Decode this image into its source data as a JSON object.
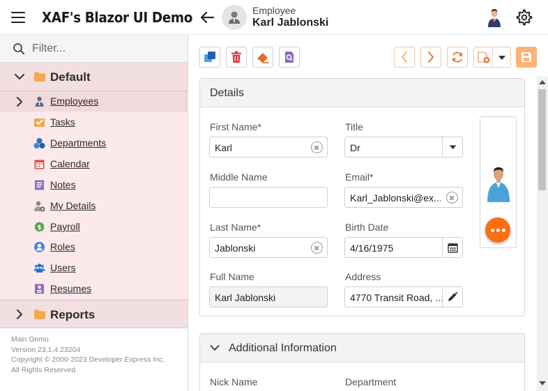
{
  "app": {
    "title": "XAF's Blazor UI Demo"
  },
  "header": {
    "object_type": "Employee",
    "object_name": "Karl Jablonski"
  },
  "sidebar": {
    "filter_placeholder": "Filter...",
    "groups": [
      {
        "label": "Default",
        "expanded": true
      },
      {
        "label": "Reports",
        "expanded": false
      }
    ],
    "items": [
      {
        "label": "Employees",
        "icon": "employee-icon"
      },
      {
        "label": "Tasks",
        "icon": "tasks-icon"
      },
      {
        "label": "Departments",
        "icon": "departments-icon"
      },
      {
        "label": "Calendar",
        "icon": "calendar-icon"
      },
      {
        "label": "Notes",
        "icon": "notes-icon"
      },
      {
        "label": "My Details",
        "icon": "my-details-icon"
      },
      {
        "label": "Payroll",
        "icon": "payroll-icon"
      },
      {
        "label": "Roles",
        "icon": "roles-icon"
      },
      {
        "label": "Users",
        "icon": "users-icon"
      },
      {
        "label": "Resumes",
        "icon": "resumes-icon"
      }
    ],
    "selected": "Employees",
    "footer": {
      "line1": "Main Demo",
      "line2": "Version 23.1.4.23204",
      "line3": "Copyright © 2000-2023 Developer Express Inc.",
      "line4": "All Rights Reserved"
    }
  },
  "toolbar": {
    "buttons": [
      "new-icon",
      "delete-icon",
      "reset-icon",
      "preview-icon",
      "previous-icon",
      "next-icon",
      "refresh-icon",
      "save-and-new-icon",
      "dropdown-icon",
      "save-icon"
    ],
    "accent_color": "#fb6f10"
  },
  "details": {
    "title": "Details",
    "first_name": {
      "label": "First Name*",
      "value": "Karl"
    },
    "middle_name": {
      "label": "Middle Name",
      "value": ""
    },
    "last_name": {
      "label": "Last Name*",
      "value": "Jablonski"
    },
    "full_name": {
      "label": "Full Name",
      "value": "Karl Jablonski"
    },
    "title_field": {
      "label": "Title",
      "value": "Dr"
    },
    "email": {
      "label": "Email*",
      "value": "Karl_Jablonski@ex..."
    },
    "birth_date": {
      "label": "Birth Date",
      "value": "4/16/1975"
    },
    "address": {
      "label": "Address",
      "value": "4770 Transit Road, ..."
    }
  },
  "additional": {
    "title": "Additional Information",
    "nick_name_label": "Nick Name",
    "department_label": "Department"
  },
  "colors": {
    "sidebar_group_bg": "#f2dfe2",
    "sidebar_list_bg": "#fbe9ec",
    "fab": "#fb6f10",
    "save_button": "#fbb478"
  }
}
